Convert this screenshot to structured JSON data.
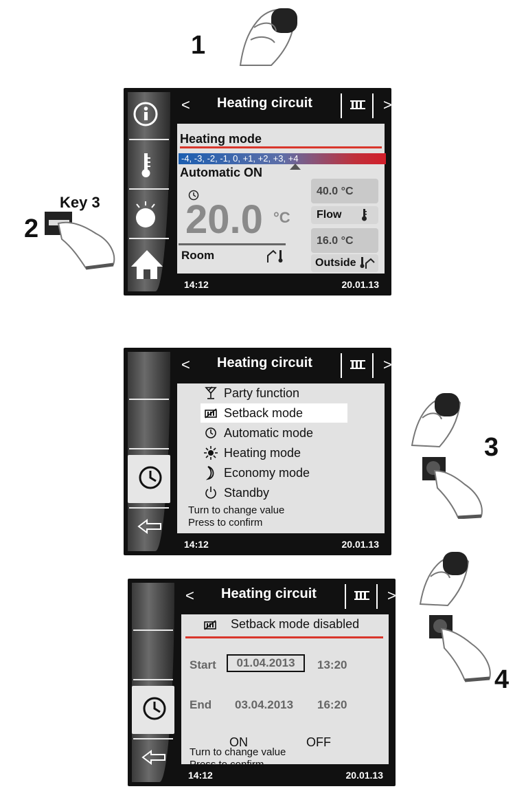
{
  "steps": {
    "s1": "1",
    "s2": "2",
    "s3": "3",
    "s4": "4"
  },
  "key_label": "Key 3",
  "screen1": {
    "title": "Heating circuit",
    "heading": "Heating mode",
    "scale": "-4, -3, -2, -1, 0, +1, +2, +3, +4",
    "mode": "Automatic ON",
    "temp_value": "20.0",
    "temp_unit": "°C",
    "room_label": "Room",
    "flow_value": "40.0 °C",
    "flow_label": "Flow",
    "outside_value": "16.0 °C",
    "outside_label": "Outside",
    "time": "14:12",
    "date": "20.01.13",
    "accent": "#d9362b"
  },
  "screen2": {
    "title": "Heating circuit",
    "items": [
      {
        "label": "Party function",
        "icon": "party-icon"
      },
      {
        "label": "Setback mode",
        "icon": "setback-icon"
      },
      {
        "label": "Automatic mode",
        "icon": "clock-icon"
      },
      {
        "label": "Heating mode",
        "icon": "sun-icon"
      },
      {
        "label": "Economy mode",
        "icon": "moon-icon"
      },
      {
        "label": "Standby",
        "icon": "power-icon"
      }
    ],
    "selected_index": 1,
    "hint1": "Turn to change value",
    "hint2": "Press to confirm",
    "time": "14:12",
    "date": "20.01.13"
  },
  "screen3": {
    "title": "Heating circuit",
    "status": "Setback mode disabled",
    "start_label": "Start",
    "start_date": "01.04.2013",
    "start_time": "13:20",
    "end_label": "End",
    "end_date": "03.04.2013",
    "end_time": "16:20",
    "on_label": "ON",
    "off_label": "OFF",
    "hint1": "Turn to change value",
    "hint2": "Press to confirm",
    "time": "14:12",
    "date": "20.01.13"
  }
}
